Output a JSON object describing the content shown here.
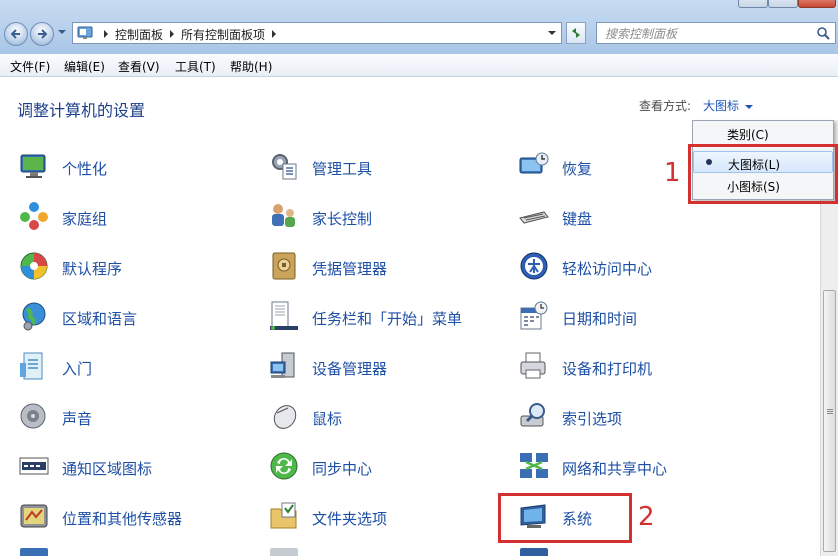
{
  "address": {
    "breadcrumbs": [
      "控制面板",
      "所有控制面板项"
    ]
  },
  "search": {
    "placeholder": "搜索控制面板"
  },
  "menu": [
    "文件(F)",
    "编辑(E)",
    "查看(V)",
    "工具(T)",
    "帮助(H)"
  ],
  "content": {
    "heading": "调整计算机的设置",
    "view_by_label": "查看方式:",
    "view_by_value": "大图标"
  },
  "view_dropdown": {
    "options": [
      "类别(C)",
      "大图标(L)",
      "小图标(S)"
    ],
    "selected": "大图标(L)"
  },
  "items": [
    {
      "label": "个性化",
      "icon": "personalization-icon"
    },
    {
      "label": "管理工具",
      "icon": "admin-tools-icon"
    },
    {
      "label": "恢复",
      "icon": "recovery-icon"
    },
    {
      "label": "家庭组",
      "icon": "homegroup-icon"
    },
    {
      "label": "家长控制",
      "icon": "parental-controls-icon"
    },
    {
      "label": "键盘",
      "icon": "keyboard-icon"
    },
    {
      "label": "默认程序",
      "icon": "default-programs-icon"
    },
    {
      "label": "凭据管理器",
      "icon": "credential-manager-icon"
    },
    {
      "label": "轻松访问中心",
      "icon": "ease-of-access-icon"
    },
    {
      "label": "区域和语言",
      "icon": "region-language-icon"
    },
    {
      "label": "任务栏和「开始」菜单",
      "icon": "taskbar-icon"
    },
    {
      "label": "日期和时间",
      "icon": "date-time-icon"
    },
    {
      "label": "入门",
      "icon": "getting-started-icon"
    },
    {
      "label": "设备管理器",
      "icon": "device-manager-icon"
    },
    {
      "label": "设备和打印机",
      "icon": "devices-printers-icon"
    },
    {
      "label": "声音",
      "icon": "sound-icon"
    },
    {
      "label": "鼠标",
      "icon": "mouse-icon"
    },
    {
      "label": "索引选项",
      "icon": "indexing-options-icon"
    },
    {
      "label": "通知区域图标",
      "icon": "notification-area-icon"
    },
    {
      "label": "同步中心",
      "icon": "sync-center-icon"
    },
    {
      "label": "网络和共享中心",
      "icon": "network-sharing-icon"
    },
    {
      "label": "位置和其他传感器",
      "icon": "location-sensors-icon"
    },
    {
      "label": "文件夹选项",
      "icon": "folder-options-icon"
    },
    {
      "label": "系统",
      "icon": "system-icon"
    }
  ],
  "annotations": [
    "1",
    "2"
  ],
  "colors": {
    "accent_link": "#1d4fa5",
    "annotation_red": "#d3302f",
    "heading": "#1e3f8a"
  }
}
